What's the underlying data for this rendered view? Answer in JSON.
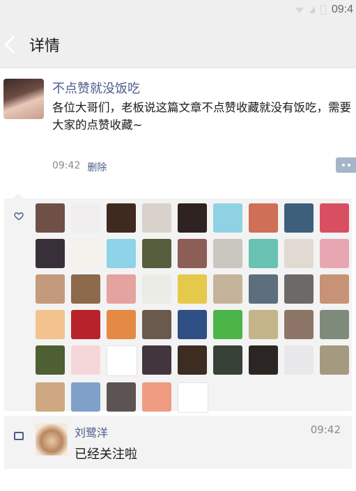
{
  "status_bar": {
    "time": "09:4"
  },
  "nav": {
    "title": "详情"
  },
  "post": {
    "author": "不点赞就没饭吃",
    "content": "各位大哥们，老板说这篇文章不点赞收藏就没有饭吃，需要大家的点赞收藏~",
    "time": "09:42",
    "delete_label": "删除"
  },
  "likes": {
    "avatar_colors": [
      "#6f5046",
      "#f0eeee",
      "#3f2a20",
      "#d8d2cb",
      "#2e2321",
      "#8fd2e3",
      "#cf6f55",
      "#3d5f7c",
      "#d94f62",
      "#383038",
      "#f5f2ee",
      "#8fd3e8",
      "#555f3d",
      "#8c5e56",
      "#c9c6c0",
      "#67c2b2",
      "#e1dad3",
      "#e7a7b2",
      "#c49a7d",
      "#8d6a4b",
      "#e4a2a0",
      "#ecece6",
      "#e5c94a",
      "#c5b39b",
      "#5d6e7c",
      "#6c6a68",
      "#c89277",
      "#f2c38d",
      "#b8232b",
      "#e48a44",
      "#6a5a4e",
      "#2d4f84",
      "#4cb548",
      "#c3b48a",
      "#8c7566",
      "#7e8a7a",
      "#4e5f33",
      "#f6d7d9",
      "#ffffff",
      "#42353d",
      "#3c2c22",
      "#384138",
      "#2b2624",
      "#e8e8ea",
      "#a49a80",
      "#cda880",
      "#7fa1c9",
      "#5b5452",
      "#ef9b82",
      "#ffffff"
    ]
  },
  "comment": {
    "author": "刘鹭洋",
    "time": "09:42",
    "text": "已经关注啦"
  }
}
